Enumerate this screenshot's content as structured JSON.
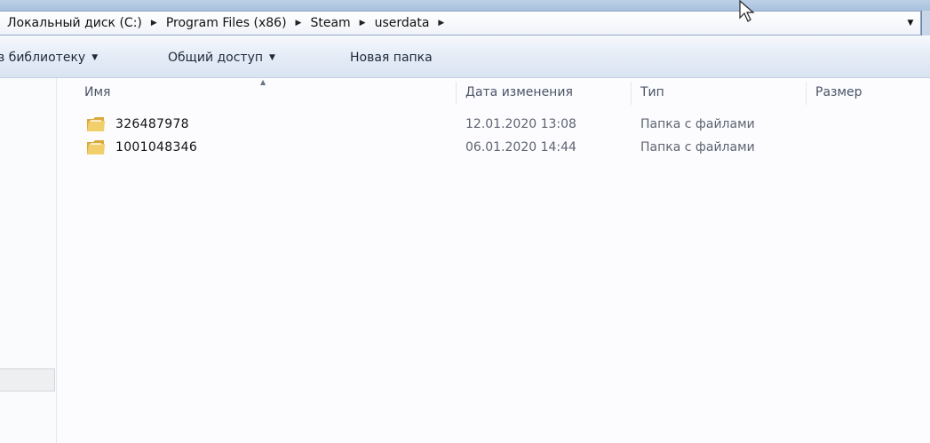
{
  "address_bar": {
    "crumbs": [
      "Локальный диск (C:)",
      "Program Files (x86)",
      "Steam",
      "userdata"
    ],
    "separator_icon": "chevron-right-icon",
    "dropdown_icon": "chevron-down-icon"
  },
  "toolbar": {
    "library_label": "в библиотеку",
    "share_label": "Общий доступ",
    "new_folder_label": "Новая папка"
  },
  "columns": {
    "name": "Имя",
    "date": "Дата изменения",
    "type": "Тип",
    "size": "Размер"
  },
  "rows": [
    {
      "name": "326487978",
      "date": "12.01.2020 13:08",
      "type": "Папка с файлами",
      "icon": "folder-icon"
    },
    {
      "name": "1001048346",
      "date": "06.01.2020 14:44",
      "type": "Папка с файлами",
      "icon": "folder-icon"
    }
  ],
  "colors": {
    "toolbar_bg": "#e3ebf6",
    "folder_yellow": "#e8c25a",
    "secondary_text": "#5e6470"
  }
}
